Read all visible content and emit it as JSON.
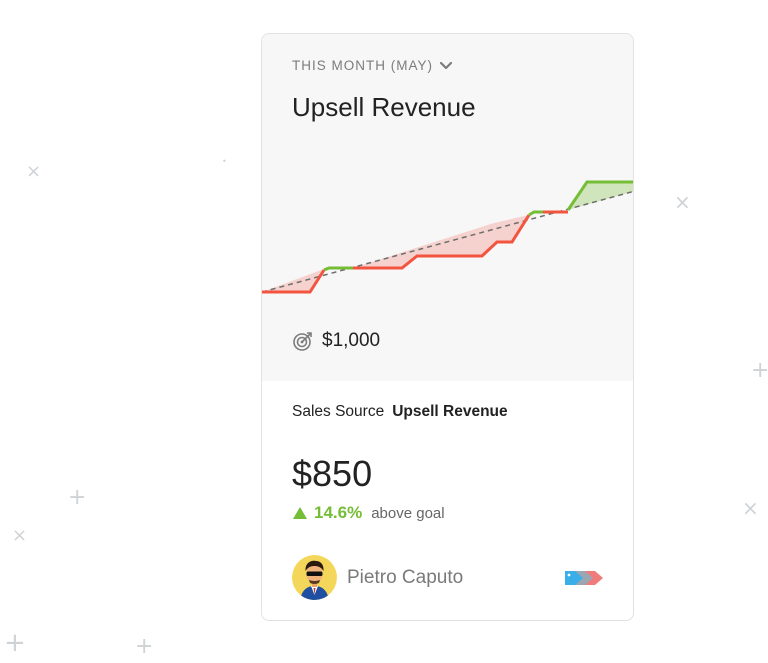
{
  "card": {
    "period_label": "THIS MONTH (MAY)",
    "title": "Upsell Revenue",
    "goal": "$1,000",
    "sales_source_label": "Sales Source",
    "sales_source_value": "Upsell Revenue",
    "amount": "$850",
    "delta_percent": "14.6%",
    "delta_text": "above goal",
    "user_name": "Pietro Caputo"
  },
  "colors": {
    "accent_up": "#76bd36",
    "accent_down": "#f2543f",
    "tag_blue": "#3aaee8",
    "tag_gray": "#9aa7b2",
    "tag_red": "#f07b7b"
  },
  "icons": {
    "period": "chevron-down-icon",
    "goal": "target-icon",
    "tags": "tags-icon"
  }
}
